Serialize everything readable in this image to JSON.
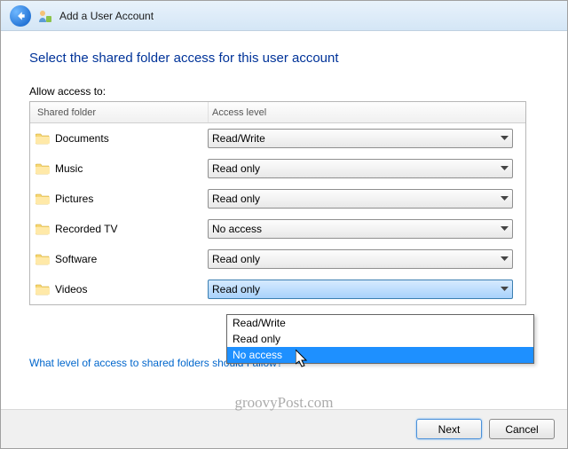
{
  "header": {
    "title": "Add a User Account"
  },
  "instruction": "Select the shared folder access for this user account",
  "allow_label": "Allow access to:",
  "columns": {
    "folder": "Shared folder",
    "access": "Access level"
  },
  "rows": [
    {
      "name": "Documents",
      "access": "Read/Write"
    },
    {
      "name": "Music",
      "access": "Read only"
    },
    {
      "name": "Pictures",
      "access": "Read only"
    },
    {
      "name": "Recorded TV",
      "access": "No access"
    },
    {
      "name": "Software",
      "access": "Read only"
    },
    {
      "name": "Videos",
      "access": "Read only"
    }
  ],
  "dropdown": {
    "options": [
      "Read/Write",
      "Read only",
      "No access"
    ],
    "highlighted": "No access"
  },
  "help_link": "What level of access to shared folders should I allow?",
  "buttons": {
    "next": "Next",
    "cancel": "Cancel"
  },
  "watermark": "groovyPost.com"
}
